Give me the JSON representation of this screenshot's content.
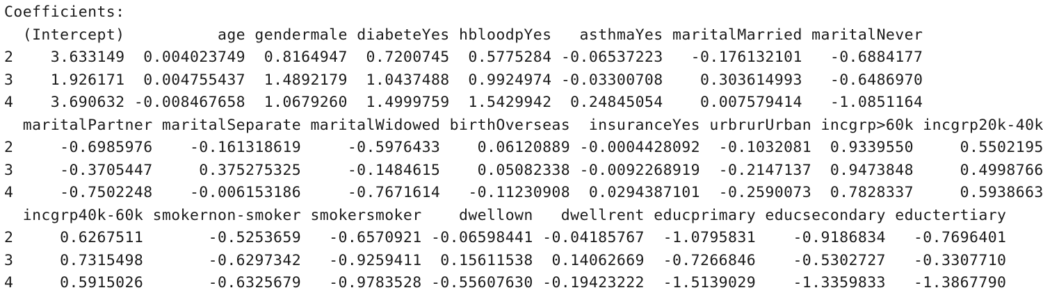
{
  "console": {
    "header": "Coefficients:",
    "blocks": [
      {
        "columns": [
          "(Intercept)",
          "age",
          "gendermale",
          "diabeteYes",
          "hbloodpYes",
          "asthmaYes",
          "maritalMarried",
          "maritalNever"
        ],
        "rows": [
          {
            "label": "2",
            "values": [
              "3.633149",
              "0.004023749",
              "0.8164947",
              "0.7200745",
              "0.5775284",
              "-0.06537223",
              "-0.176132101",
              "-0.6884177"
            ]
          },
          {
            "label": "3",
            "values": [
              "1.926171",
              "0.004755437",
              "1.4892179",
              "1.0437488",
              "0.9924974",
              "-0.03300708",
              "0.303614993",
              "-0.6486970"
            ]
          },
          {
            "label": "4",
            "values": [
              "3.690632",
              "-0.008467658",
              "1.0679260",
              "1.4999759",
              "1.5429942",
              "0.24845054",
              "0.007579414",
              "-1.0851164"
            ]
          }
        ]
      },
      {
        "columns": [
          "maritalPartner",
          "maritalSeparate",
          "maritalWidowed",
          "birthOverseas",
          "insuranceYes",
          "urbrurUrban",
          "incgrp>60k",
          "incgrp20k-40k"
        ],
        "rows": [
          {
            "label": "2",
            "values": [
              "-0.6985976",
              "-0.161318619",
              "-0.5976433",
              "0.06120889",
              "-0.0004428092",
              "-0.1032081",
              "0.9339550",
              "0.5502195"
            ]
          },
          {
            "label": "3",
            "values": [
              "-0.3705447",
              "0.375275325",
              "-0.1484615",
              "0.05082338",
              "-0.0092268919",
              "-0.2147137",
              "0.9473848",
              "0.4998766"
            ]
          },
          {
            "label": "4",
            "values": [
              "-0.7502248",
              "-0.006153186",
              "-0.7671614",
              "-0.11230908",
              "0.0294387101",
              "-0.2590073",
              "0.7828337",
              "0.5938663"
            ]
          }
        ]
      },
      {
        "columns": [
          "incgrp40k-60k",
          "smokernon-smoker",
          "smokersmoker",
          "dwellown",
          "dwellrent",
          "educprimary",
          "educsecondary",
          "eductertiary"
        ],
        "rows": [
          {
            "label": "2",
            "values": [
              "0.6267511",
              "-0.5253659",
              "-0.6570921",
              "-0.06598441",
              "-0.04185767",
              "-1.0795831",
              "-0.9186834",
              "-0.7696401"
            ]
          },
          {
            "label": "3",
            "values": [
              "0.7315498",
              "-0.6297342",
              "-0.9259411",
              "0.15611538",
              "0.14062669",
              "-0.7266846",
              "-0.5302727",
              "-0.3307710"
            ]
          },
          {
            "label": "4",
            "values": [
              "0.5915026",
              "-0.6325679",
              "-0.9783528",
              "-0.55607630",
              "-0.19423222",
              "-1.5139029",
              "-1.3359833",
              "-1.3867790"
            ]
          }
        ]
      }
    ]
  }
}
